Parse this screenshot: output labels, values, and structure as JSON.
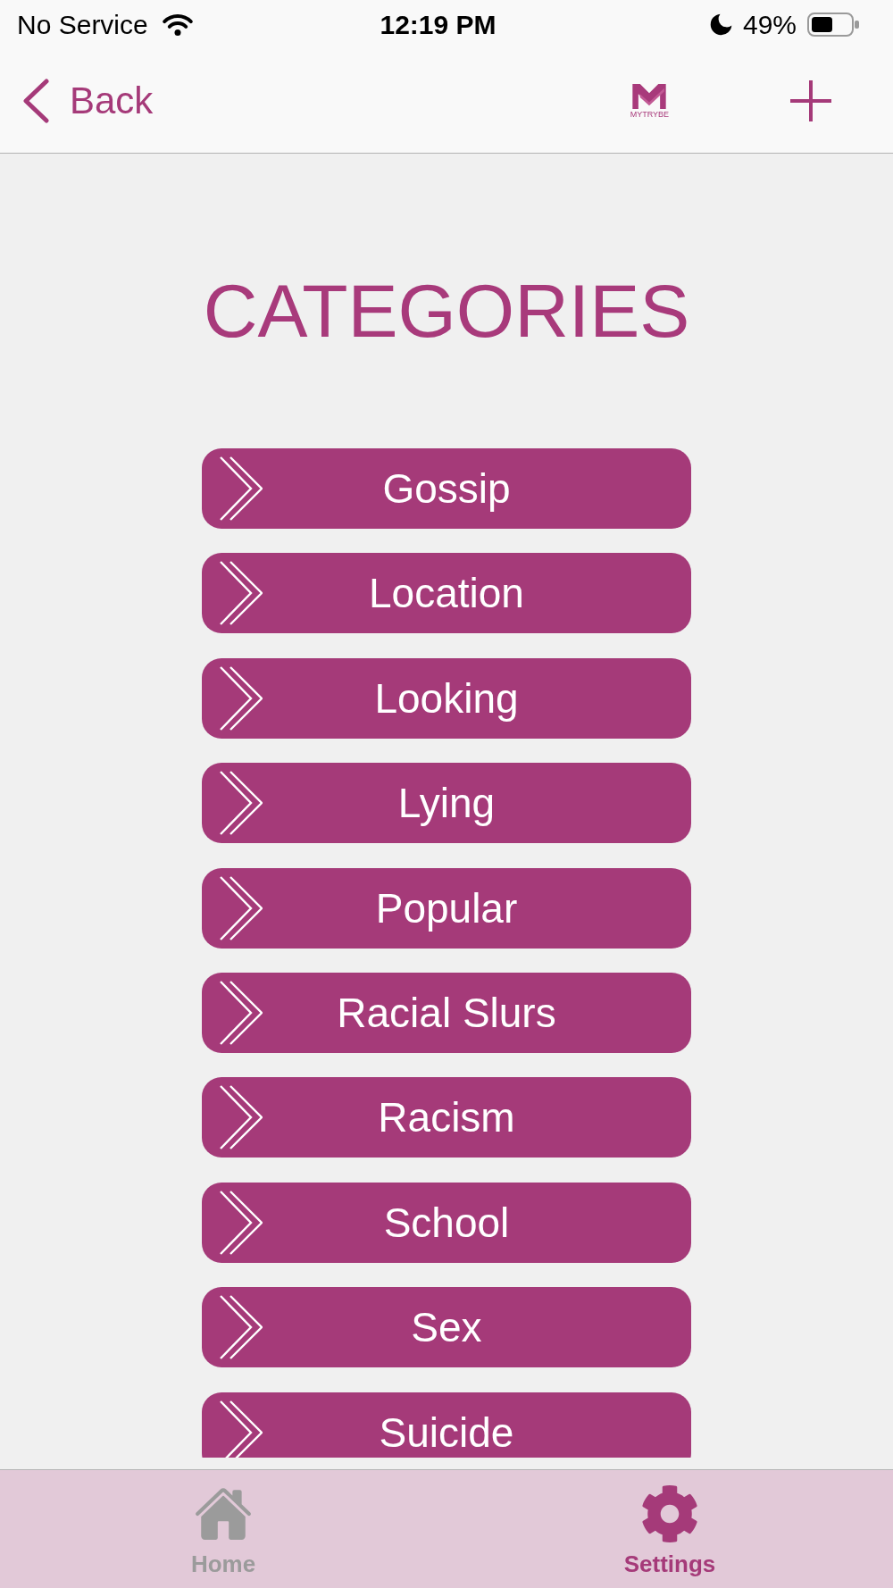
{
  "status_bar": {
    "carrier": "No Service",
    "time": "12:19 PM",
    "battery": "49%"
  },
  "nav_bar": {
    "back": "Back",
    "logo_text": "MYTRYBE"
  },
  "title": "CATEGORIES",
  "categories": [
    {
      "label": "Gossip"
    },
    {
      "label": "Location"
    },
    {
      "label": "Looking"
    },
    {
      "label": "Lying"
    },
    {
      "label": "Popular"
    },
    {
      "label": "Racial Slurs"
    },
    {
      "label": "Racism"
    },
    {
      "label": "School"
    },
    {
      "label": "Sex"
    },
    {
      "label": "Suicide"
    }
  ],
  "tab_bar": [
    {
      "label": "Home",
      "selected": false
    },
    {
      "label": "Settings",
      "selected": true
    }
  ]
}
